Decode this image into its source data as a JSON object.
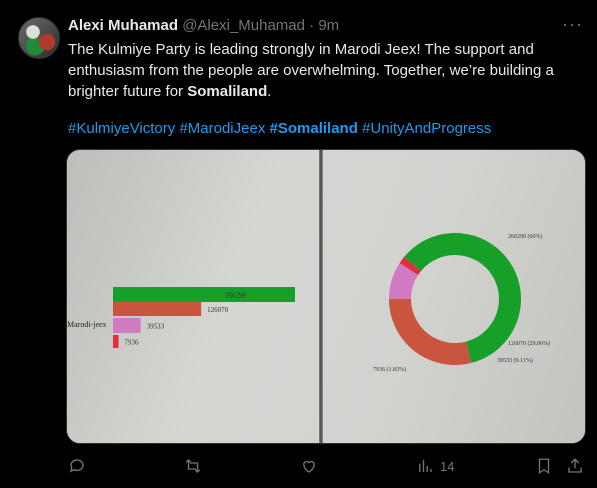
{
  "tweet": {
    "name": "Alexi Muhamad",
    "handle": "@Alexi_Muhamad",
    "dot": "·",
    "time": "9m",
    "more": "···",
    "text_before": "The Kulmiye Party is leading strongly in Marodi Jeex!  The support and enthusiasm from the people are overwhelming. Together, we’re building a brighter future for ",
    "text_bold": "Somaliland",
    "text_after": ".",
    "hashtags": [
      "#KulmiyeVictory",
      "#MarodiJeex",
      "#Somaliland",
      "#UnityAndProgress"
    ]
  },
  "actions": {
    "views_count": "14"
  },
  "colors": {
    "green": "#16a02a",
    "red": "#c9553e",
    "pink": "#d07ac2",
    "crimson": "#e0303f"
  },
  "chart_data": [
    {
      "type": "bar",
      "orientation": "horizontal",
      "categories": [
        "Marodi-jeex"
      ],
      "series": [
        {
          "values": [
            260290
          ]
        },
        {
          "values": [
            126070
          ]
        },
        {
          "values": [
            39533
          ]
        },
        {
          "values": [
            7936
          ]
        }
      ],
      "data_labels": [
        "260290",
        "126070",
        "39533",
        "7936"
      ],
      "category_label": "Marodi-jeex"
    },
    {
      "type": "pie",
      "style": "donut",
      "values": [
        260290,
        126070,
        39533,
        7936
      ],
      "labels": [
        "260290 (60%)",
        "126070 (29.06%)",
        "39533 (9.11%)",
        "7936 (1.83%)"
      ]
    }
  ]
}
